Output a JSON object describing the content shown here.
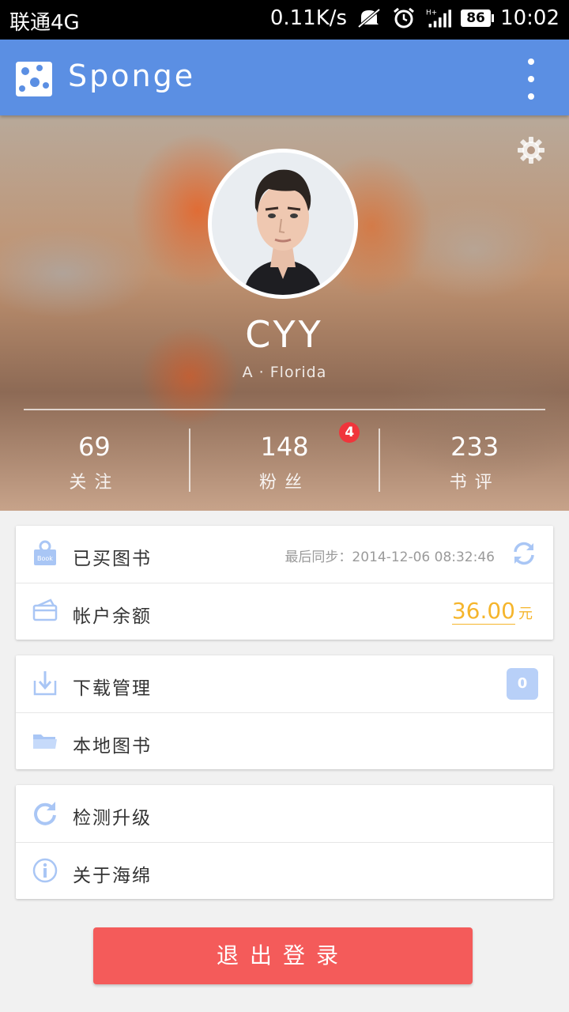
{
  "status_bar": {
    "carrier": "联通4G",
    "speed": "0.11K/s",
    "network_label": "H+",
    "battery": "86",
    "time": "10:02",
    "icons": [
      "mute-icon",
      "alarm-icon",
      "signal-icon",
      "battery-icon"
    ]
  },
  "app_bar": {
    "title": "Sponge",
    "logo_icon": "sponge-logo-icon",
    "menu_icon": "more-vert-icon"
  },
  "profile": {
    "name": "CYY",
    "location": "A · Florida",
    "settings_icon": "gear-icon",
    "stats": [
      {
        "value": "69",
        "label": "关注"
      },
      {
        "value": "148",
        "label": "粉丝",
        "badge": "4"
      },
      {
        "value": "233",
        "label": "书评"
      }
    ]
  },
  "menu": {
    "group1": {
      "purchased": {
        "label": "已买图书",
        "sync_text": "最后同步：2014-12-06  08:32:46",
        "icon": "book-bag-icon"
      },
      "balance": {
        "label": "帐户余额",
        "amount": "36.00",
        "unit": "元",
        "icon": "card-icon"
      }
    },
    "group2": {
      "downloads": {
        "label": "下载管理",
        "count": "0",
        "icon": "download-icon"
      },
      "local": {
        "label": "本地图书",
        "icon": "folder-icon"
      }
    },
    "group3": {
      "update": {
        "label": "检测升级",
        "icon": "refresh-icon"
      },
      "about": {
        "label": "关于海绵",
        "icon": "info-icon"
      }
    }
  },
  "logout_label": "退出登录",
  "colors": {
    "app_bar": "#5b8fe3",
    "accent_orange": "#f5b52c",
    "logout": "#f45b5a",
    "icon_blue": "#a9c6f5",
    "badge_red": "#f0353b"
  }
}
